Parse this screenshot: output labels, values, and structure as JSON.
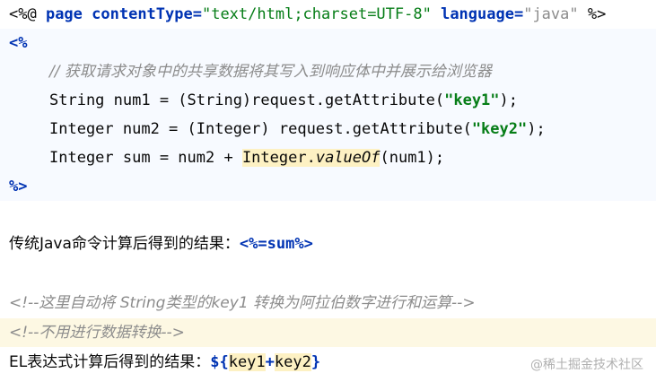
{
  "code": {
    "directive": {
      "open": "<%@ ",
      "page_kw": "page",
      "attr1_name": " contentType=",
      "attr1_value": "\"text/html;charset=UTF-8\"",
      "attr2_name": " language=",
      "attr2_value": "\"java\"",
      "close": " %>"
    },
    "scriptlet_open": "<%",
    "comment": "// 获取请求对象中的共享数据将其写入到响应体中并展示给浏览器",
    "line1": {
      "pre": "String num1 = (String)request.getAttribute(",
      "arg": "\"key1\"",
      "post": ");"
    },
    "line2": {
      "pre": "Integer num2 = (Integer) request.getAttribute(",
      "arg": "\"key2\"",
      "post": ");"
    },
    "line3": {
      "pre": "Integer sum = num2 + ",
      "cls": "Integer.",
      "method": "valueOf",
      "post": "(num1);"
    },
    "scriptlet_close": "%>",
    "traditional": {
      "label": "传统Java命令计算后得到的结果：",
      "expr": "<%=sum%>"
    },
    "html_comment1": "<!--这里自动将 String类型的key1 转换为阿拉伯数字进行和运算-->",
    "html_comment2": "<!--不用进行数据转换-->",
    "el": {
      "label": "EL表达式计算后得到的结果：",
      "open": "${",
      "k1": "key1",
      "plus": "+",
      "k2": "key2",
      "close": "}"
    }
  },
  "watermark": "@稀土掘金技术社区"
}
